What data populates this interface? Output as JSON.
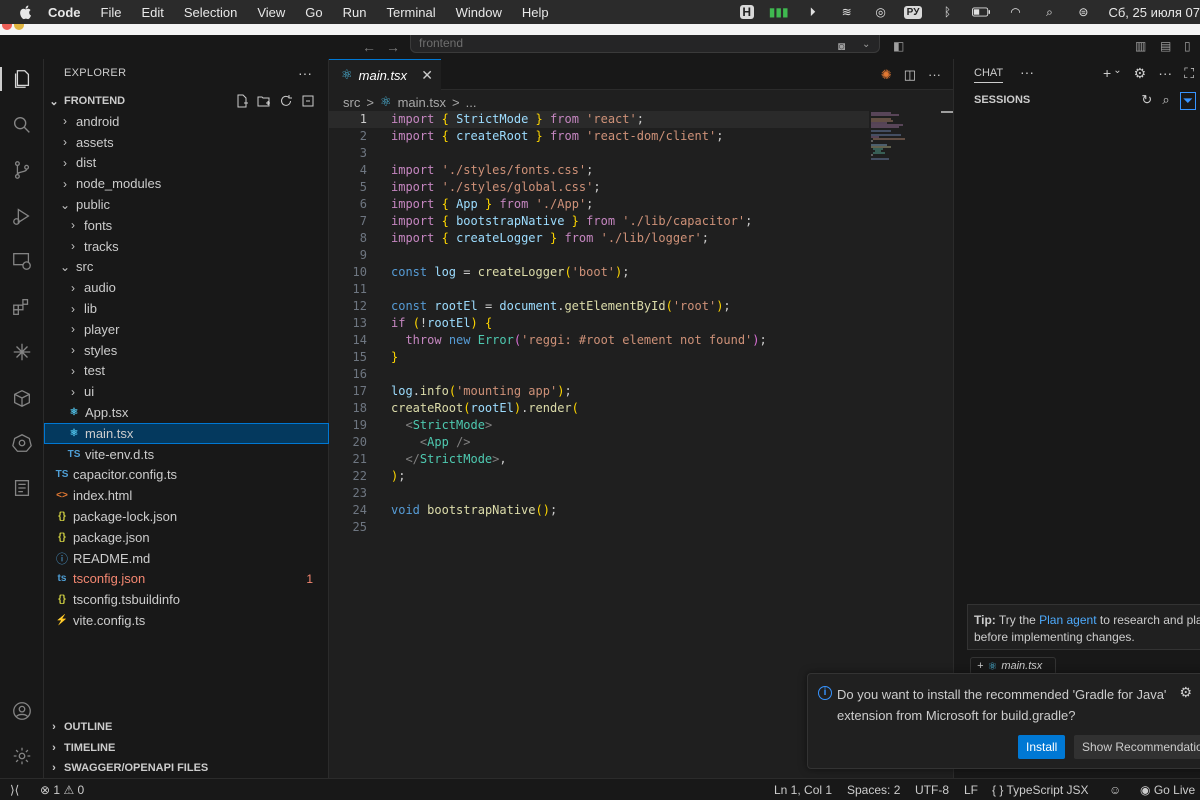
{
  "menubar": {
    "app": "Code",
    "items": [
      "File",
      "Edit",
      "Selection",
      "View",
      "Go",
      "Run",
      "Terminal",
      "Window",
      "Help"
    ],
    "input_lang": "РУ",
    "clock": "Сб, 25 июля  07"
  },
  "titlebar": {
    "search_text": "frontend"
  },
  "explorer": {
    "title": "EXPLORER",
    "root": "FRONTEND",
    "items": [
      {
        "label": "android",
        "type": "folder",
        "open": false
      },
      {
        "label": "assets",
        "type": "folder",
        "open": false
      },
      {
        "label": "dist",
        "type": "folder",
        "open": false
      },
      {
        "label": "node_modules",
        "type": "folder",
        "open": false
      },
      {
        "label": "public",
        "type": "folder",
        "open": true
      },
      {
        "label": "fonts",
        "type": "folder",
        "open": false
      },
      {
        "label": "tracks",
        "type": "folder",
        "open": false
      },
      {
        "label": "src",
        "type": "folder",
        "open": true
      },
      {
        "label": "audio",
        "type": "folder",
        "open": false
      },
      {
        "label": "lib",
        "type": "folder",
        "open": false
      },
      {
        "label": "player",
        "type": "folder",
        "open": false
      },
      {
        "label": "styles",
        "type": "folder",
        "open": false
      },
      {
        "label": "test",
        "type": "folder",
        "open": false
      },
      {
        "label": "ui",
        "type": "folder",
        "open": false
      },
      {
        "label": "App.tsx",
        "type": "react"
      },
      {
        "label": "main.tsx",
        "type": "react",
        "selected": true
      },
      {
        "label": "vite-env.d.ts",
        "type": "ts",
        "icon": "TS"
      },
      {
        "label": "capacitor.config.ts",
        "type": "ts",
        "icon": "TS"
      },
      {
        "label": "index.html",
        "type": "html",
        "icon": "<>"
      },
      {
        "label": "package-lock.json",
        "type": "json",
        "icon": "{}"
      },
      {
        "label": "package.json",
        "type": "json",
        "icon": "{}"
      },
      {
        "label": "README.md",
        "type": "info",
        "icon": "ⓘ"
      },
      {
        "label": "tsconfig.json",
        "type": "tsconfig",
        "icon": "ts",
        "badge": "1"
      },
      {
        "label": "tsconfig.tsbuildinfo",
        "type": "json",
        "icon": "{}"
      },
      {
        "label": "vite.config.ts",
        "type": "vite"
      }
    ],
    "sections": [
      "OUTLINE",
      "TIMELINE",
      "SWAGGER/OPENAPI FILES"
    ]
  },
  "editor": {
    "tab_label": "main.tsx",
    "breadcrumb": [
      "src",
      ">",
      "main.tsx",
      ">",
      "..."
    ],
    "line_numbers": [
      "1",
      "2",
      "3",
      "4",
      "5",
      "6",
      "7",
      "8",
      "9",
      "10",
      "11",
      "12",
      "13",
      "14",
      "15",
      "16",
      "17",
      "18",
      "19",
      "20",
      "21",
      "22",
      "23",
      "24",
      "25"
    ]
  },
  "chat": {
    "title": "CHAT",
    "sessions_label": "SESSIONS",
    "tip_label": "Tip:",
    "tip_text_1": " Try the ",
    "tip_link": "Plan agent",
    "tip_text_2": " to research and pla",
    "tip_line2": "before implementing changes.",
    "attachment": "main.tsx"
  },
  "notification": {
    "message": "Do you want to install the recommended 'Gradle for Java' extension from Microsoft for build.gradle?",
    "install_label": "Install",
    "show_label": "Show Recommendatio"
  },
  "statusbar": {
    "errors": "1",
    "warnings": "0",
    "position": "Ln 1, Col 1",
    "spaces": "Spaces: 2",
    "encoding": "UTF-8",
    "eol": "LF",
    "language": "TypeScript JSX",
    "go_live": "Go Live"
  },
  "colors": {
    "accent": "#0078d4",
    "error": "#f48771",
    "link": "#4daafc"
  }
}
